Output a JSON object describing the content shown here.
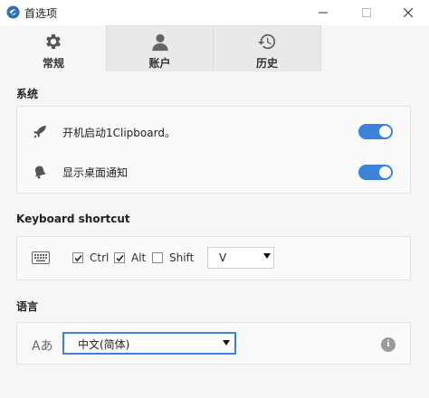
{
  "window": {
    "title": "首选项",
    "icon": "app-logo-icon"
  },
  "tabs": [
    {
      "label": "常规",
      "icon": "gear-icon",
      "active": true
    },
    {
      "label": "账户",
      "icon": "user-icon",
      "active": false
    },
    {
      "label": "历史",
      "icon": "history-icon",
      "active": false
    }
  ],
  "system": {
    "title": "系统",
    "startup_label": "开机启动1Clipboard。",
    "startup_enabled": true,
    "notify_label": "显示桌面通知",
    "notify_enabled": true
  },
  "shortcut": {
    "title": "Keyboard shortcut",
    "ctrl_label": "Ctrl",
    "ctrl_checked": true,
    "alt_label": "Alt",
    "alt_checked": true,
    "shift_label": "Shift",
    "shift_checked": false,
    "key_value": "V"
  },
  "language": {
    "title": "语言",
    "icon_text": "Aあ",
    "selected": "中文(简体)"
  },
  "colors": {
    "accent": "#3b82d8",
    "background": "#f6f6f6"
  }
}
